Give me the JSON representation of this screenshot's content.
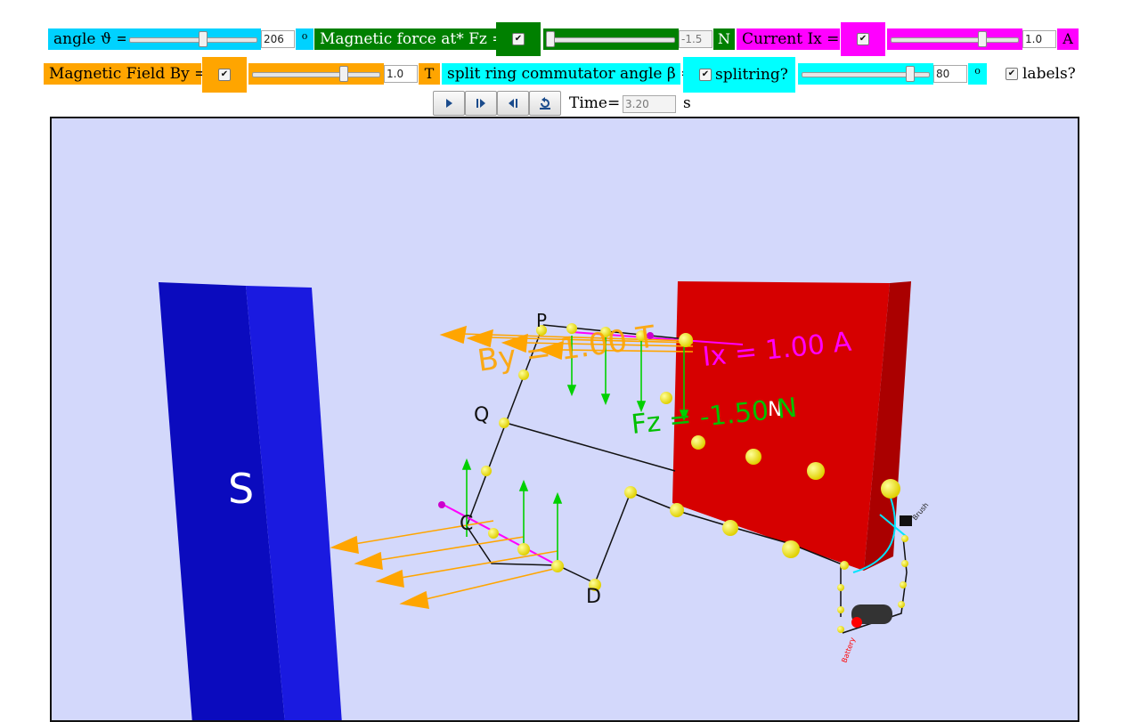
{
  "controls": {
    "angle": {
      "label": "angle ϑ =",
      "value": "206",
      "unit": "o",
      "slider_fraction": 0.58
    },
    "force": {
      "label": "Magnetic force at* Fz =",
      "checked": true,
      "value": "-1.5",
      "unit": "N",
      "slider_fraction": 0.0
    },
    "current": {
      "label": "Current Ix =",
      "checked": true,
      "value": "1.0",
      "unit": "A",
      "slider_fraction": 0.73
    },
    "field": {
      "label": "Magnetic Field By =",
      "checked": true,
      "value": "1.0",
      "unit": "T",
      "slider_fraction": 0.73
    },
    "split_ring": {
      "label": "split ring commutator angle β =",
      "checkbox_label": "splitring?",
      "checked": true,
      "value": "80",
      "unit": "o",
      "slider_fraction": 0.87
    },
    "labels": {
      "checkbox_label": "labels?",
      "checked": true
    }
  },
  "playback": {
    "time_label": "Time=",
    "time_value": "3.20",
    "time_unit": "s"
  },
  "colors": {
    "cyan": "#00d2ff",
    "green": "#008000",
    "magenta": "#ff00ff",
    "orange": "#ffa500",
    "scene_bg": "#d3d8fb",
    "south_magnet": "#0d0dc4",
    "north_magnet": "#d80000"
  },
  "scene": {
    "south_pole": "S",
    "north_pole": "N",
    "by_label": "By = 1.00 T",
    "ix_label": "Ix = 1.00 A",
    "fz_label": "Fz = -1.50 N",
    "point_p": "P",
    "point_q": "Q",
    "point_c": "C",
    "point_d": "D",
    "brush_label": "Brush",
    "battery_label": "Battery"
  }
}
